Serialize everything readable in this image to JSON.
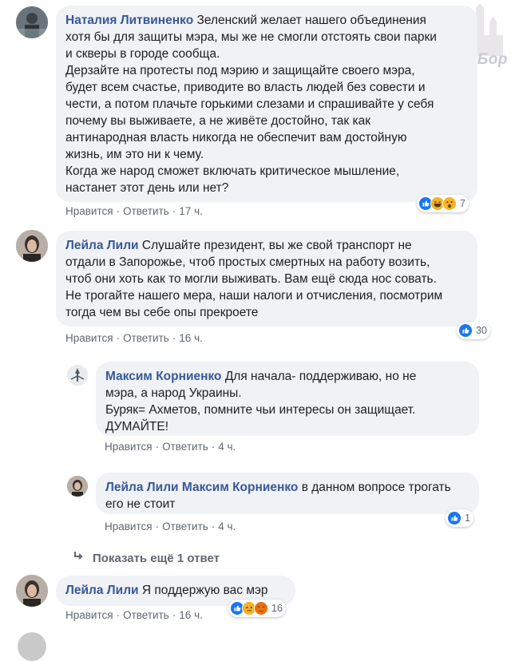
{
  "actions": {
    "like": "Нравится",
    "reply": "Ответить",
    "separator": "·"
  },
  "watermark": {
    "text": "ZaБор"
  },
  "comments": [
    {
      "author": "Наталия Литвиненко",
      "lines": [
        "Зеленский желает нашего объединения",
        "хотя бы для защиты мэра, мы же не смогли отстоять свои парки",
        "и скверы в городе сообща.",
        "Дерзайте на протесты под мэрию и защищайте своего мэра,",
        "будет всем счастье, приводите во власть людей без совести и",
        "чести, а потом плачьте горькими слезами и спрашивайте у себя",
        "почему вы выживаете, а не живёте достойно, так как",
        "антинародная власть никогда не обеспечит вам достойную",
        "жизнь, им это ни к чему.",
        "Когда же народ сможет включать критическое мышление,",
        "настанет этот день или нет?"
      ],
      "time": "17 ч.",
      "reaction_count": "7",
      "reaction_icons": [
        "like",
        "haha",
        "wow"
      ]
    },
    {
      "author": "Лейла Лили",
      "lines": [
        "Слушайте президент, вы же свой транспорт не",
        "отдали в Запорожье, чтоб простых смертных на работу возить,",
        "чтоб они хоть как то могли выживать. Вам ещё сюда нос совать.",
        "Не трогайте нашего мера, наши налоги и отчисления, посмотрим",
        "тогда чем вы себе опы прекроете"
      ],
      "time": "16 ч.",
      "reaction_count": "30",
      "reaction_icons": [
        "like"
      ]
    },
    {
      "author": "Максим Корниенко",
      "lines": [
        "Для начала- поддерживаю, но не",
        "мэра, а народ Украины.",
        "Буряк= Ахметов, помните чьи интересы он защищает.",
        "ДУМАЙТЕ!"
      ],
      "time": "4 ч."
    },
    {
      "author": "Лейла Лили",
      "mention": "Максим Корниенко",
      "lines": [
        "в данном вопросе трогать",
        "его не стоит"
      ],
      "time": "4 ч.",
      "reaction_count": "1",
      "reaction_icons": [
        "like"
      ]
    },
    {
      "author": "Лейла Лили",
      "lines": [
        "Я поддержую вас мэр"
      ],
      "time": "16 ч.",
      "reaction_count": "16",
      "reaction_icons": [
        "like",
        "sad",
        "angry"
      ]
    }
  ],
  "more_replies": "Показать ещё 1 ответ"
}
